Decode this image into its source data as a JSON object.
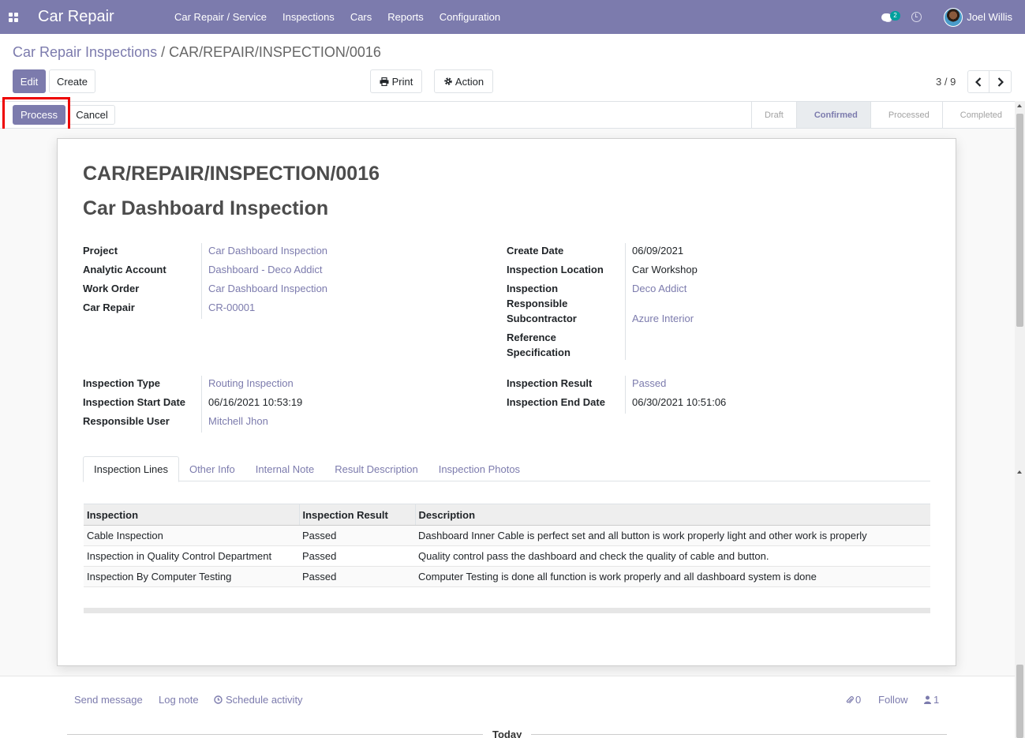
{
  "navbar": {
    "app_name": "Car Repair",
    "menu": [
      "Car Repair / Service",
      "Inspections",
      "Cars",
      "Reports",
      "Configuration"
    ],
    "message_count": "2",
    "user_name": "Joel Willis",
    "bg_color": "#7c7bad"
  },
  "breadcrumb": {
    "parent": "Car Repair Inspections",
    "separator": "/",
    "current": "CAR/REPAIR/INSPECTION/0016"
  },
  "toolbar": {
    "edit_label": "Edit",
    "create_label": "Create",
    "print_label": "Print",
    "action_label": "Action",
    "pager": "3 / 9"
  },
  "statusbar": {
    "process_label": "Process",
    "cancel_label": "Cancel",
    "stages": [
      "Draft",
      "Confirmed",
      "Processed",
      "Completed"
    ],
    "active_stage": "Confirmed"
  },
  "record": {
    "name": "CAR/REPAIR/INSPECTION/0016",
    "title": "Car Dashboard Inspection",
    "left_fields": [
      {
        "label": "Project",
        "value": "Car Dashboard Inspection"
      },
      {
        "label": "Analytic Account",
        "value": "Dashboard - Deco Addict"
      },
      {
        "label": "Work Order",
        "value": "Car Dashboard Inspection"
      },
      {
        "label": "Car Repair",
        "value": "CR-00001"
      }
    ],
    "right_fields": {
      "create_date_label": "Create Date",
      "create_date": "06/09/2021",
      "location_label": "Inspection Location",
      "location": "Car Workshop",
      "responsible_label": "Inspection Responsible",
      "responsible": "Deco Addict",
      "subcontractor_label": "Subcontractor",
      "subcontractor": "Azure Interior",
      "reference_label": "Reference Specification",
      "reference": ""
    },
    "left_fields2": [
      {
        "label": "Inspection Type",
        "value": "Routing Inspection"
      },
      {
        "label": "Inspection Start Date",
        "value": "06/16/2021 10:53:19"
      },
      {
        "label": "Responsible User",
        "value": "Mitchell Jhon"
      }
    ],
    "right_fields2": [
      {
        "label": "Inspection Result",
        "value": "Passed"
      },
      {
        "label": "Inspection End Date",
        "value": "06/30/2021 10:51:06"
      }
    ]
  },
  "tabs": [
    "Inspection Lines",
    "Other Info",
    "Internal Note",
    "Result Description",
    "Inspection Photos"
  ],
  "lines": {
    "headers": [
      "Inspection",
      "Inspection Result",
      "Description"
    ],
    "rows": [
      [
        "Cable Inspection",
        "Passed",
        "Dashboard Inner Cable is perfect set and all button is work properly light and other work is properly"
      ],
      [
        "Inspection in Quality Control Department",
        "Passed",
        "Quality control pass the dashboard and check the quality of cable and button."
      ],
      [
        "Inspection By Computer Testing",
        "Passed",
        "Computer Testing is done all function is work properly and all dashboard system is done"
      ]
    ]
  },
  "chatter": {
    "send_message": "Send message",
    "log_note": "Log note",
    "schedule_activity": "Schedule activity",
    "attachments": "0",
    "follow": "Follow",
    "followers": "1",
    "today": "Today"
  }
}
